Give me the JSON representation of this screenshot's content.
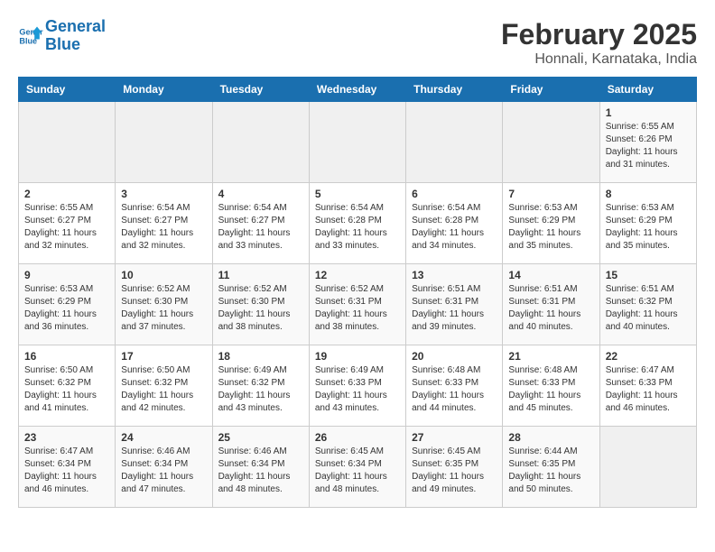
{
  "header": {
    "logo_line1": "General",
    "logo_line2": "Blue",
    "month_title": "February 2025",
    "subtitle": "Honnali, Karnataka, India"
  },
  "days_of_week": [
    "Sunday",
    "Monday",
    "Tuesday",
    "Wednesday",
    "Thursday",
    "Friday",
    "Saturday"
  ],
  "weeks": [
    [
      {
        "day": "",
        "info": ""
      },
      {
        "day": "",
        "info": ""
      },
      {
        "day": "",
        "info": ""
      },
      {
        "day": "",
        "info": ""
      },
      {
        "day": "",
        "info": ""
      },
      {
        "day": "",
        "info": ""
      },
      {
        "day": "1",
        "info": "Sunrise: 6:55 AM\nSunset: 6:26 PM\nDaylight: 11 hours and 31 minutes."
      }
    ],
    [
      {
        "day": "2",
        "info": "Sunrise: 6:55 AM\nSunset: 6:27 PM\nDaylight: 11 hours and 32 minutes."
      },
      {
        "day": "3",
        "info": "Sunrise: 6:54 AM\nSunset: 6:27 PM\nDaylight: 11 hours and 32 minutes."
      },
      {
        "day": "4",
        "info": "Sunrise: 6:54 AM\nSunset: 6:27 PM\nDaylight: 11 hours and 33 minutes."
      },
      {
        "day": "5",
        "info": "Sunrise: 6:54 AM\nSunset: 6:28 PM\nDaylight: 11 hours and 33 minutes."
      },
      {
        "day": "6",
        "info": "Sunrise: 6:54 AM\nSunset: 6:28 PM\nDaylight: 11 hours and 34 minutes."
      },
      {
        "day": "7",
        "info": "Sunrise: 6:53 AM\nSunset: 6:29 PM\nDaylight: 11 hours and 35 minutes."
      },
      {
        "day": "8",
        "info": "Sunrise: 6:53 AM\nSunset: 6:29 PM\nDaylight: 11 hours and 35 minutes."
      }
    ],
    [
      {
        "day": "9",
        "info": "Sunrise: 6:53 AM\nSunset: 6:29 PM\nDaylight: 11 hours and 36 minutes."
      },
      {
        "day": "10",
        "info": "Sunrise: 6:52 AM\nSunset: 6:30 PM\nDaylight: 11 hours and 37 minutes."
      },
      {
        "day": "11",
        "info": "Sunrise: 6:52 AM\nSunset: 6:30 PM\nDaylight: 11 hours and 38 minutes."
      },
      {
        "day": "12",
        "info": "Sunrise: 6:52 AM\nSunset: 6:31 PM\nDaylight: 11 hours and 38 minutes."
      },
      {
        "day": "13",
        "info": "Sunrise: 6:51 AM\nSunset: 6:31 PM\nDaylight: 11 hours and 39 minutes."
      },
      {
        "day": "14",
        "info": "Sunrise: 6:51 AM\nSunset: 6:31 PM\nDaylight: 11 hours and 40 minutes."
      },
      {
        "day": "15",
        "info": "Sunrise: 6:51 AM\nSunset: 6:32 PM\nDaylight: 11 hours and 40 minutes."
      }
    ],
    [
      {
        "day": "16",
        "info": "Sunrise: 6:50 AM\nSunset: 6:32 PM\nDaylight: 11 hours and 41 minutes."
      },
      {
        "day": "17",
        "info": "Sunrise: 6:50 AM\nSunset: 6:32 PM\nDaylight: 11 hours and 42 minutes."
      },
      {
        "day": "18",
        "info": "Sunrise: 6:49 AM\nSunset: 6:32 PM\nDaylight: 11 hours and 43 minutes."
      },
      {
        "day": "19",
        "info": "Sunrise: 6:49 AM\nSunset: 6:33 PM\nDaylight: 11 hours and 43 minutes."
      },
      {
        "day": "20",
        "info": "Sunrise: 6:48 AM\nSunset: 6:33 PM\nDaylight: 11 hours and 44 minutes."
      },
      {
        "day": "21",
        "info": "Sunrise: 6:48 AM\nSunset: 6:33 PM\nDaylight: 11 hours and 45 minutes."
      },
      {
        "day": "22",
        "info": "Sunrise: 6:47 AM\nSunset: 6:33 PM\nDaylight: 11 hours and 46 minutes."
      }
    ],
    [
      {
        "day": "23",
        "info": "Sunrise: 6:47 AM\nSunset: 6:34 PM\nDaylight: 11 hours and 46 minutes."
      },
      {
        "day": "24",
        "info": "Sunrise: 6:46 AM\nSunset: 6:34 PM\nDaylight: 11 hours and 47 minutes."
      },
      {
        "day": "25",
        "info": "Sunrise: 6:46 AM\nSunset: 6:34 PM\nDaylight: 11 hours and 48 minutes."
      },
      {
        "day": "26",
        "info": "Sunrise: 6:45 AM\nSunset: 6:34 PM\nDaylight: 11 hours and 48 minutes."
      },
      {
        "day": "27",
        "info": "Sunrise: 6:45 AM\nSunset: 6:35 PM\nDaylight: 11 hours and 49 minutes."
      },
      {
        "day": "28",
        "info": "Sunrise: 6:44 AM\nSunset: 6:35 PM\nDaylight: 11 hours and 50 minutes."
      },
      {
        "day": "",
        "info": ""
      }
    ]
  ]
}
